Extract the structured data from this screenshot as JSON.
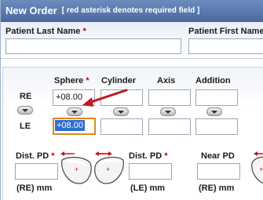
{
  "header": {
    "title": "New Order",
    "note": "[ red asterisk denotes required field ]"
  },
  "patient": {
    "last_name_label": "Patient Last Name",
    "first_name_label": "Patient First Name",
    "required_mark": "*",
    "last_name_value": "",
    "first_name_value": ""
  },
  "rx": {
    "columns": {
      "sphere": "Sphere",
      "cylinder": "Cylinder",
      "axis": "Axis",
      "addition": "Addition"
    },
    "rows": {
      "re": "RE",
      "le": "LE"
    },
    "values": {
      "re_sphere": "+08.00",
      "re_cylinder": "",
      "re_axis": "",
      "re_addition": "",
      "le_sphere": "+08.00",
      "le_cylinder": "",
      "le_axis": "",
      "le_addition": ""
    },
    "colors": {
      "arrow": "#c0181f",
      "focus_border": "#d98a1f",
      "selection": "#2f6fd1"
    }
  },
  "pd": {
    "dist_pd_label": "Dist. PD",
    "dist_pd_le_label": "Dist. PD",
    "near_pd_label": "Near PD",
    "re_unit": "(RE) mm",
    "le_unit": "(LE) mm",
    "re_unit_near": "(RE) mm",
    "dist_pd_value": "",
    "dist_pd_le_value": "",
    "near_pd_value": "",
    "icons": [
      "pd-arrow-icon",
      "lens-icon"
    ]
  }
}
